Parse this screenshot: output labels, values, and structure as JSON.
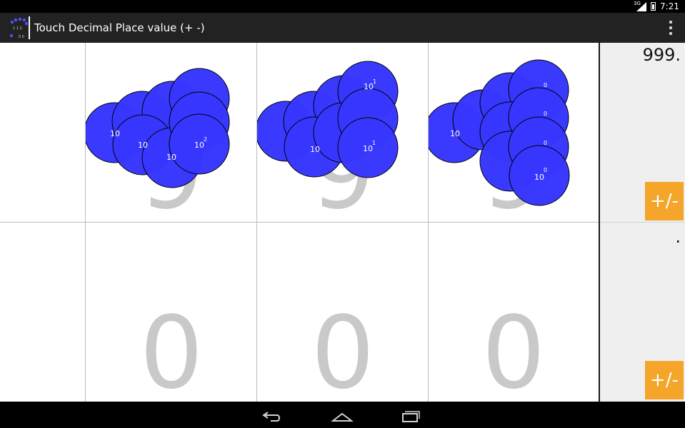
{
  "status_bar": {
    "network": "3G",
    "time": "7:21"
  },
  "action_bar": {
    "title": "Touch Decimal Place value (+ -)",
    "icon": "app-icon",
    "menu_icon": "overflow-menu-icon"
  },
  "colors": {
    "chip_fill": "#3636ff",
    "digit": "#c9c9c9",
    "button": "#f5a52a",
    "action_bar": "#222222"
  },
  "top_row": {
    "digits": [
      "9",
      "9",
      "9"
    ],
    "chip_labels": {
      "hundreds": "10",
      "tens": "10",
      "ones": "10"
    },
    "chip_exponents": {
      "hundreds": "2",
      "tens": "1",
      "ones": "0"
    },
    "readout": "999.",
    "sign_button": "+/-"
  },
  "bottom_row": {
    "digits": [
      "0",
      "0",
      "0"
    ],
    "readout": ".",
    "sign_button": "+/-"
  },
  "nav_bar": {
    "back": "back-icon",
    "home": "home-icon",
    "recents": "recents-icon"
  }
}
